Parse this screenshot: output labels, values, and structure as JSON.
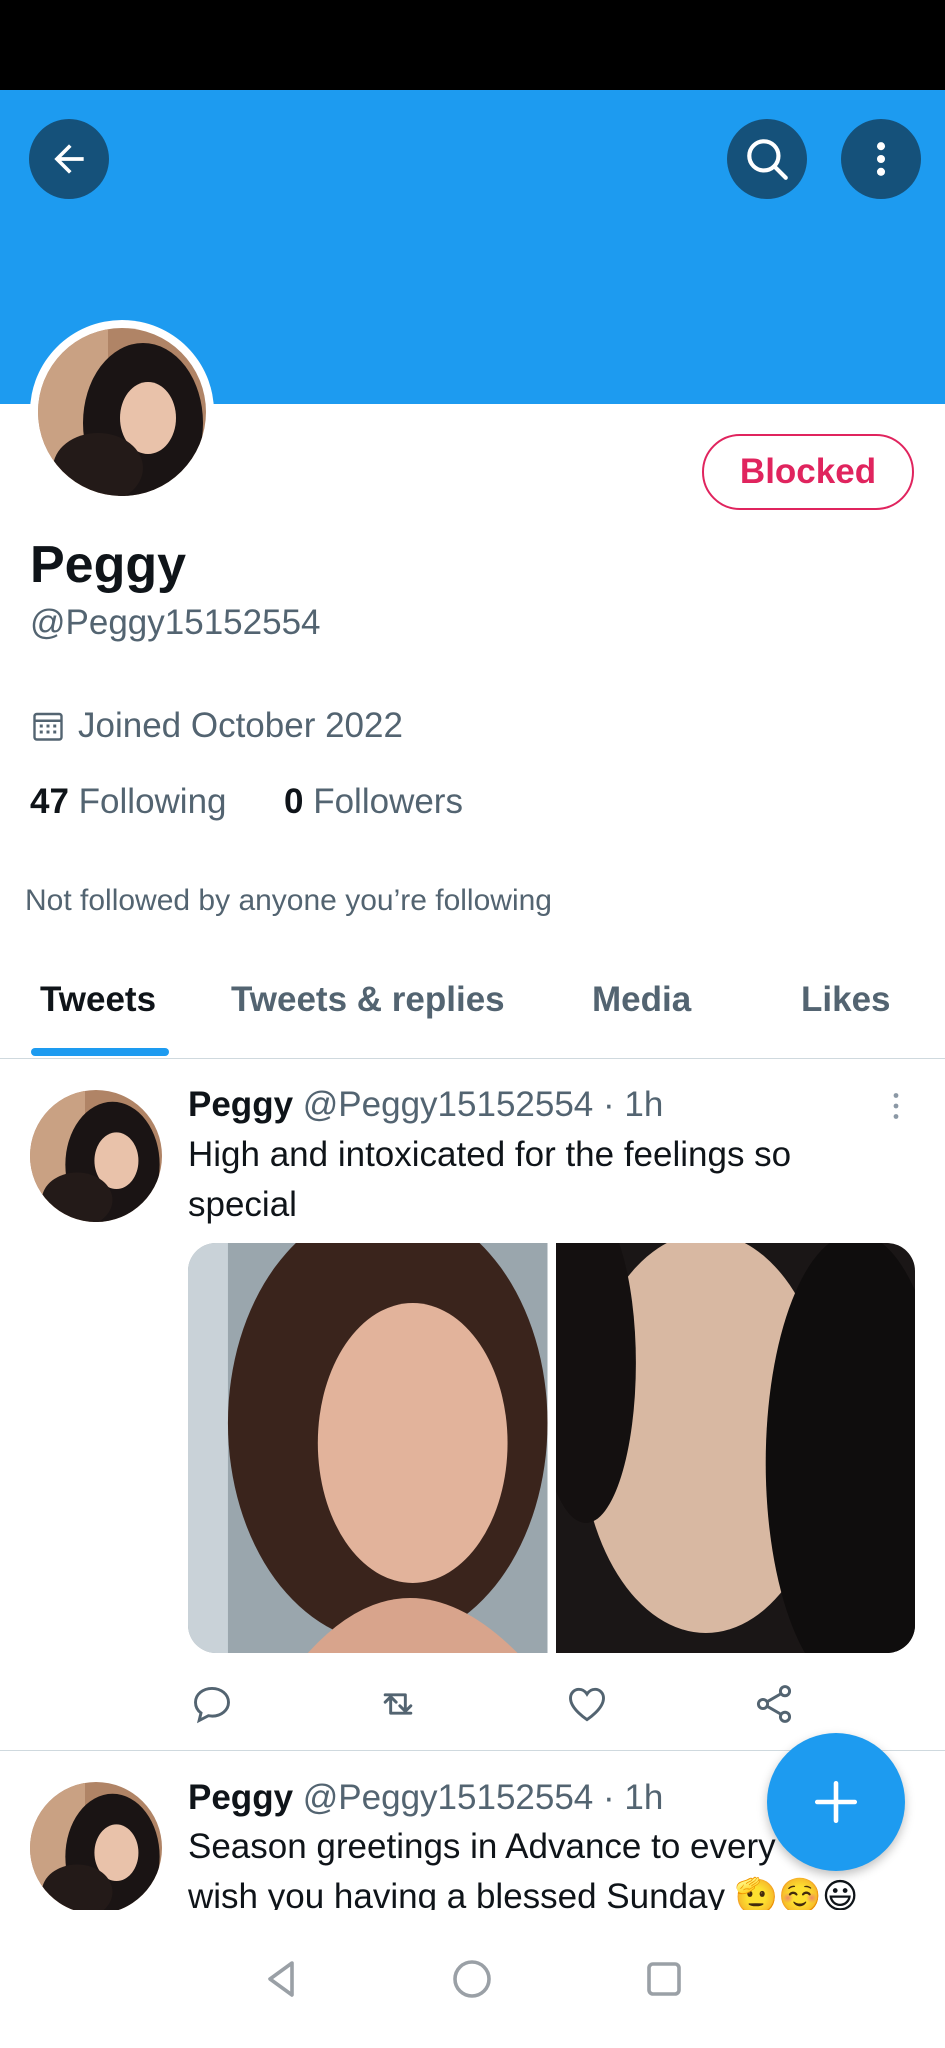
{
  "colors": {
    "accent": "#1d9bf0",
    "blocked": "#e0245e",
    "text": "#0f1419",
    "muted": "#536471"
  },
  "header": {
    "back_icon": "arrow-left-icon",
    "search_icon": "search-icon",
    "more_icon": "more-vertical-icon"
  },
  "profile": {
    "name": "Peggy",
    "handle": "@Peggy15152554",
    "blocked_label": "Blocked",
    "joined": "Joined October 2022",
    "following_count": "47",
    "following_label": "Following",
    "followers_count": "0",
    "followers_label": "Followers",
    "not_followed": "Not followed by anyone you’re following"
  },
  "tabs": [
    {
      "label": "Tweets",
      "active": true
    },
    {
      "label": "Tweets & replies",
      "active": false
    },
    {
      "label": "Media",
      "active": false
    },
    {
      "label": "Likes",
      "active": false
    }
  ],
  "tweets": [
    {
      "name": "Peggy",
      "handle": "@Peggy15152554",
      "time": "· 1h",
      "text_line1": "High and intoxicated for the feelings so",
      "text_line2": "special"
    },
    {
      "name": "Peggy",
      "handle": "@Peggy15152554",
      "time": "· 1h",
      "text_line1": "Season greetings in Advance to every",
      "text_line2": "wish you having a blessed Sunday 🫡☺️😃"
    }
  ],
  "actions": [
    "reply-icon",
    "retweet-icon",
    "like-icon",
    "share-icon"
  ],
  "fab": {
    "icon": "plus-icon"
  },
  "nav": [
    "back-triangle-icon",
    "home-circle-icon",
    "recents-square-icon"
  ]
}
